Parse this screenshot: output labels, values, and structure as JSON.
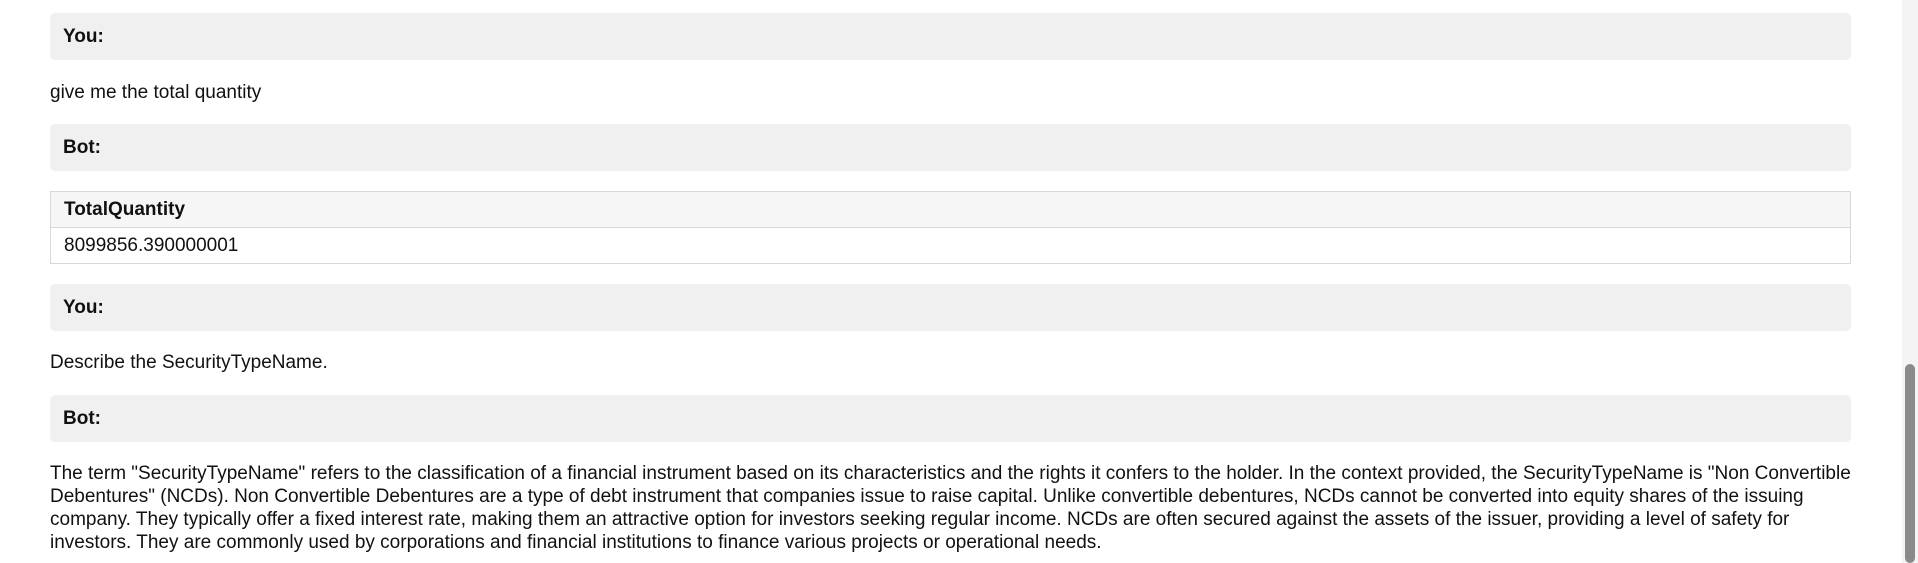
{
  "messages": [
    {
      "speaker": "You:",
      "text": "give me the total quantity"
    },
    {
      "speaker": "Bot:",
      "table": {
        "headers": [
          "TotalQuantity"
        ],
        "rows": [
          [
            "8099856.390000001"
          ]
        ]
      }
    },
    {
      "speaker": "You:",
      "text": "Describe the SecurityTypeName."
    },
    {
      "speaker": "Bot:",
      "text": "The term \"SecurityTypeName\" refers to the classification of a financial instrument based on its characteristics and the rights it confers to the holder. In the context provided, the SecurityTypeName is \"Non Convertible Debentures\" (NCDs). Non Convertible Debentures are a type of debt instrument that companies issue to raise capital. Unlike convertible debentures, NCDs cannot be converted into equity shares of the issuing company. They typically offer a fixed interest rate, making them an attractive option for investors seeking regular income. NCDs are often secured against the assets of the issuer, providing a level of safety for investors. They are commonly used by corporations and financial institutions to finance various projects or operational needs."
    }
  ]
}
